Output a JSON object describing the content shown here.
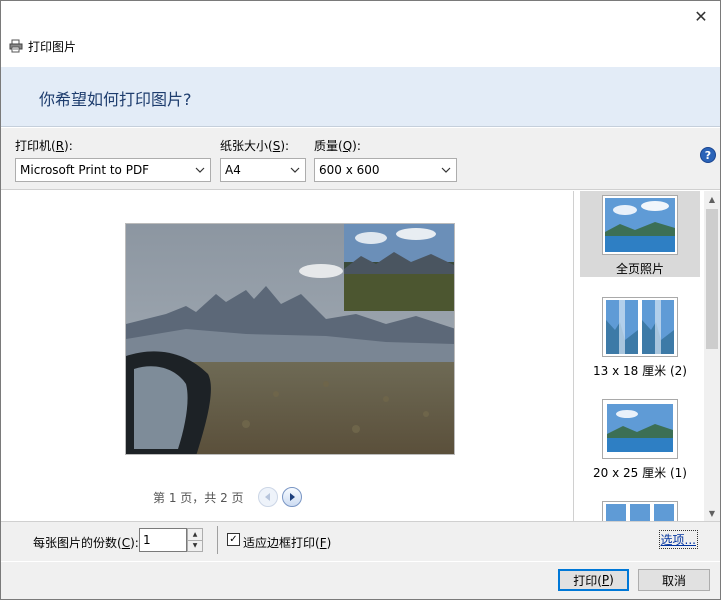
{
  "window": {
    "title": "打印图片",
    "close_glyph": "✕"
  },
  "banner": {
    "heading": "你希望如何打印图片?"
  },
  "printer": {
    "label_prefix": "打印机(",
    "label_key": "R",
    "label_suffix": "):",
    "value": "Microsoft Print to PDF"
  },
  "paper_size": {
    "label_prefix": "纸张大小(",
    "label_key": "S",
    "label_suffix": "):",
    "value": "A4"
  },
  "quality": {
    "label_prefix": "质量(",
    "label_key": "Q",
    "label_suffix": "):",
    "value": "600 x 600"
  },
  "help": {
    "glyph": "?"
  },
  "pager": {
    "text": "第 1 页，共 2 页"
  },
  "layouts": [
    {
      "caption": "全页照片",
      "selected": true
    },
    {
      "caption": "13 x 18 厘米 (2)",
      "selected": false
    },
    {
      "caption": "20 x 25 厘米 (1)",
      "selected": false
    },
    {
      "caption": "",
      "selected": false
    }
  ],
  "copies": {
    "label_prefix": "每张图片的份数(",
    "label_key": "C",
    "label_suffix": "):",
    "value": "1"
  },
  "fit_frame": {
    "label_prefix": "适应边框打印(",
    "label_key": "F",
    "label_suffix": ")",
    "checked": true
  },
  "options_link": "选项...",
  "buttons": {
    "print_prefix": "打印(",
    "print_key": "P",
    "print_suffix": ")",
    "cancel": "取消"
  },
  "colors": {
    "banner_bg": "#e3ecf7",
    "heading": "#1e3d6e",
    "link": "#0033a0",
    "default_button_border": "#0078d7"
  }
}
